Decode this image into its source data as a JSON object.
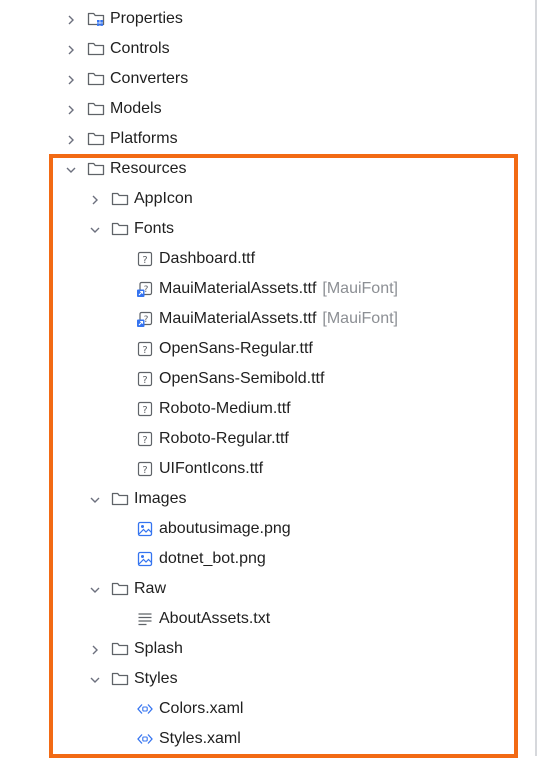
{
  "accent_color": "#f26a14",
  "tree": [
    {
      "label": "Properties",
      "depth": 0,
      "kind": "folder-special",
      "expanded": false,
      "icon": "properties-folder-icon"
    },
    {
      "label": "Controls",
      "depth": 0,
      "kind": "folder",
      "expanded": false,
      "icon": "folder-icon"
    },
    {
      "label": "Converters",
      "depth": 0,
      "kind": "folder",
      "expanded": false,
      "icon": "folder-icon"
    },
    {
      "label": "Models",
      "depth": 0,
      "kind": "folder",
      "expanded": false,
      "icon": "folder-icon"
    },
    {
      "label": "Platforms",
      "depth": 0,
      "kind": "folder",
      "expanded": false,
      "icon": "folder-icon"
    },
    {
      "label": "Resources",
      "depth": 0,
      "kind": "folder",
      "expanded": true,
      "icon": "folder-icon"
    },
    {
      "label": "AppIcon",
      "depth": 1,
      "kind": "folder",
      "expanded": false,
      "icon": "folder-icon"
    },
    {
      "label": "Fonts",
      "depth": 1,
      "kind": "folder",
      "expanded": true,
      "icon": "folder-icon"
    },
    {
      "label": "Dashboard.ttf",
      "depth": 2,
      "kind": "unknown",
      "icon": "unknown-file-icon"
    },
    {
      "label": "MauiMaterialAssets.ttf",
      "hint": "[MauiFont]",
      "depth": 2,
      "kind": "link",
      "icon": "linked-file-icon"
    },
    {
      "label": "MauiMaterialAssets.ttf",
      "hint": "[MauiFont]",
      "depth": 2,
      "kind": "link",
      "icon": "linked-file-icon"
    },
    {
      "label": "OpenSans-Regular.ttf",
      "depth": 2,
      "kind": "unknown",
      "icon": "unknown-file-icon"
    },
    {
      "label": "OpenSans-Semibold.ttf",
      "depth": 2,
      "kind": "unknown",
      "icon": "unknown-file-icon"
    },
    {
      "label": "Roboto-Medium.ttf",
      "depth": 2,
      "kind": "unknown",
      "icon": "unknown-file-icon"
    },
    {
      "label": "Roboto-Regular.ttf",
      "depth": 2,
      "kind": "unknown",
      "icon": "unknown-file-icon"
    },
    {
      "label": "UIFontIcons.ttf",
      "depth": 2,
      "kind": "unknown",
      "icon": "unknown-file-icon"
    },
    {
      "label": "Images",
      "depth": 1,
      "kind": "folder",
      "expanded": true,
      "icon": "folder-icon"
    },
    {
      "label": "aboutusimage.png",
      "depth": 2,
      "kind": "image",
      "icon": "image-file-icon"
    },
    {
      "label": "dotnet_bot.png",
      "depth": 2,
      "kind": "image",
      "icon": "image-file-icon"
    },
    {
      "label": "Raw",
      "depth": 1,
      "kind": "folder",
      "expanded": true,
      "icon": "folder-icon"
    },
    {
      "label": "AboutAssets.txt",
      "depth": 2,
      "kind": "text",
      "icon": "text-file-icon"
    },
    {
      "label": "Splash",
      "depth": 1,
      "kind": "folder",
      "expanded": false,
      "icon": "folder-icon"
    },
    {
      "label": "Styles",
      "depth": 1,
      "kind": "folder",
      "expanded": true,
      "icon": "folder-icon"
    },
    {
      "label": "Colors.xaml",
      "depth": 2,
      "kind": "xaml",
      "icon": "xaml-file-icon"
    },
    {
      "label": "Styles.xaml",
      "depth": 2,
      "kind": "xaml",
      "icon": "xaml-file-icon"
    }
  ]
}
